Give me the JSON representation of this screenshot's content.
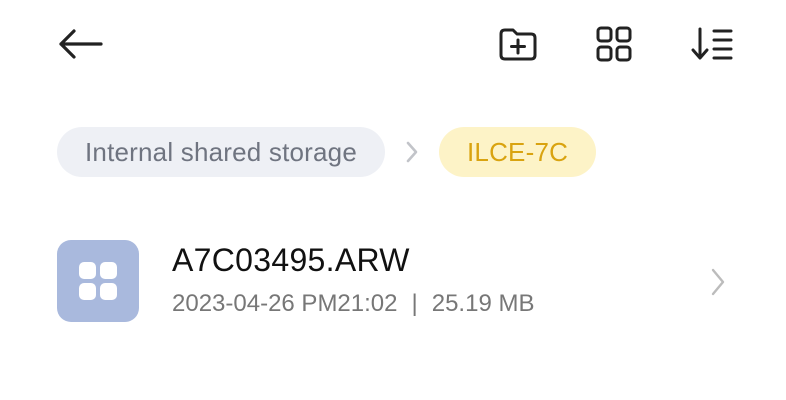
{
  "breadcrumb": {
    "root_label": "Internal shared storage",
    "current_label": "ILCE-7C"
  },
  "files": [
    {
      "name": "A7C03495.ARW",
      "date": "2023-04-26 PM21:02",
      "divider": "|",
      "size": "25.19 MB",
      "icon": "grid-app-icon"
    }
  ],
  "icons": {
    "back": "back-arrow-icon",
    "new_folder": "new-folder-icon",
    "grid_view": "grid-view-icon",
    "sort": "sort-icon",
    "breadcrumb_separator": "chevron-right-icon",
    "row_chevron": "chevron-right-icon"
  },
  "colors": {
    "crumb_root_bg": "#eef0f5",
    "crumb_root_text": "#6f7480",
    "crumb_current_bg": "#fdf3c7",
    "crumb_current_text": "#d9a310",
    "file_thumb_bg": "#a9b9dd"
  }
}
